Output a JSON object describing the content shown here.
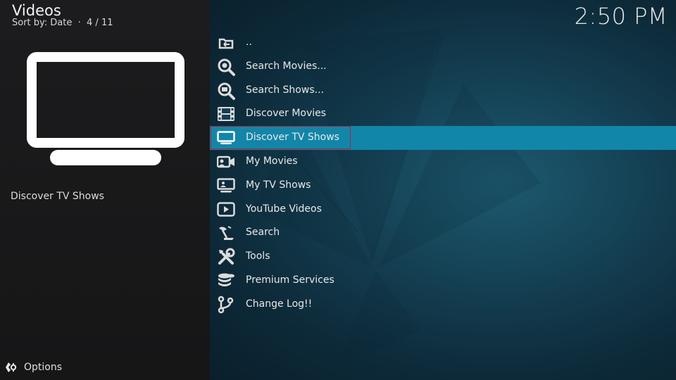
{
  "header": {
    "title": "Videos",
    "sort": "Sort by: Date  ·  4 / 11"
  },
  "clock": "2:50 PM",
  "thumbnail": {
    "icon": "tv-icon",
    "caption": "Discover TV Shows"
  },
  "footer": {
    "options_label": "Options",
    "icon": "options-gear-icon"
  },
  "list": {
    "selected_index": 4,
    "items": [
      {
        "label": "..",
        "icon": "folder-back-icon"
      },
      {
        "label": "Search Movies...",
        "icon": "search-movies-icon"
      },
      {
        "label": "Search Shows...",
        "icon": "search-shows-icon"
      },
      {
        "label": "Discover Movies",
        "icon": "film-icon"
      },
      {
        "label": "Discover TV Shows",
        "icon": "tv-icon"
      },
      {
        "label": "My Movies",
        "icon": "camera-icon"
      },
      {
        "label": "My TV Shows",
        "icon": "tv-person-icon"
      },
      {
        "label": "YouTube Videos",
        "icon": "play-icon"
      },
      {
        "label": "Search",
        "icon": "satellite-dish-icon"
      },
      {
        "label": "Tools",
        "icon": "tools-icon"
      },
      {
        "label": "Premium Services",
        "icon": "database-icon"
      },
      {
        "label": "Change Log!!",
        "icon": "branch-icon"
      }
    ]
  },
  "colors": {
    "selection": "#1286a8",
    "focus_outline": "#b0203a",
    "left_panel": "#1c1c1e",
    "background": "#0c2230"
  }
}
